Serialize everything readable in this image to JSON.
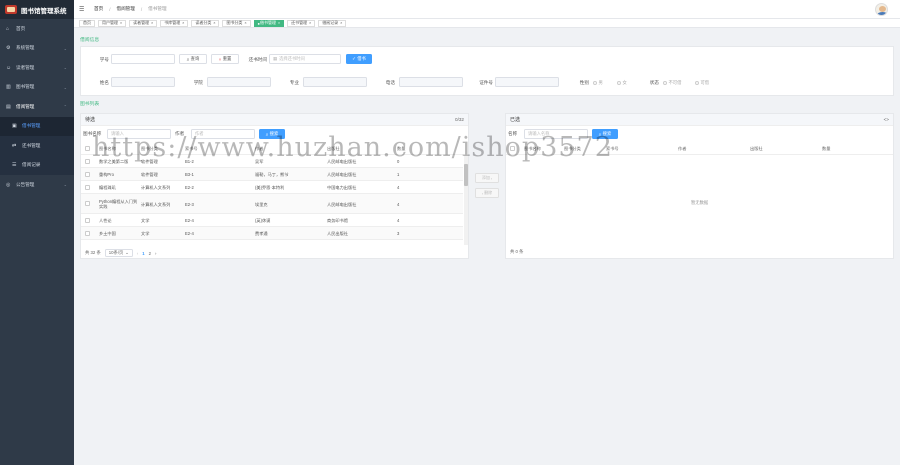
{
  "app": {
    "title": "图书馆管理系统"
  },
  "sidebar": {
    "items": [
      {
        "label": "首页",
        "icon": "home-icon"
      },
      {
        "label": "系统管理",
        "icon": "setting-icon"
      },
      {
        "label": "读者管理",
        "icon": "user-icon"
      },
      {
        "label": "图书管理",
        "icon": "book-icon"
      },
      {
        "label": "借阅管理",
        "icon": "borrow-icon"
      },
      {
        "label": "借书管理",
        "icon": "doc-icon"
      },
      {
        "label": "还书管理",
        "icon": "return-icon"
      },
      {
        "label": "借阅记录",
        "icon": "record-icon"
      },
      {
        "label": "公告管理",
        "icon": "notice-icon"
      }
    ]
  },
  "breadcrumb": [
    "首页",
    "借阅管理",
    "借书管理"
  ],
  "tabs": [
    "首页",
    "用户管理",
    "读者管理",
    "书库管理",
    "读者分类",
    "图书分类",
    "借书管理",
    "还书管理",
    "借阅记录"
  ],
  "search": {
    "section_title": "借阅信息",
    "reader_label": "学号",
    "query_label": "查询",
    "reset_label": "重置",
    "borrow_time_label": "还书时间",
    "borrow_time_placeholder": "选择还书时间",
    "confirm_label": "借书",
    "name_label": "姓名",
    "college_label": "学院",
    "major_label": "专业",
    "phone_label": "电话",
    "id_label": "证件号",
    "gender_label": "性别",
    "gender_male": "男",
    "gender_female": "女",
    "status_label": "状态",
    "status_unavailable": "不可借",
    "status_available": "可借"
  },
  "books": {
    "section_title": "图书列表",
    "left_title": "待选",
    "left_count": "0/32",
    "name_label": "图书名称",
    "name_placeholder": "请输入",
    "author_label": "作者",
    "author_placeholder": "作者",
    "search_label": "搜索",
    "columns": [
      "图书名称",
      "图书分类",
      "索书号",
      "作者",
      "出版社",
      "数量"
    ],
    "rows": [
      [
        "数学之美第二版",
        "软件管理",
        "B1-2",
        "吴军",
        "人民邮电出版社",
        "0"
      ],
      [
        "重构Pro",
        "软件管理",
        "B3-1",
        "福勒，马丁，熊节",
        "人民邮电出版社",
        "1"
      ],
      [
        "编程珠玑",
        "计算机人文系列",
        "E2-2",
        "(美)乔恩·本特利",
        "中国电力出版社",
        "4"
      ],
      [
        "Python编程从入门到实践",
        "计算机人文系列",
        "E2-3",
        "埃里克",
        "人民邮电出版社",
        "4"
      ],
      [
        "人性论",
        "文学",
        "E2-4",
        "(英)休谟",
        "商务印书馆",
        "4"
      ],
      [
        "乡土中国",
        "文学",
        "E2-4",
        "费孝通",
        "人民出版社",
        "3"
      ]
    ],
    "total": "共 32 条",
    "page_size": "10条/页",
    "pages": [
      "1",
      "2"
    ],
    "prev": "‹",
    "next": "›",
    "add_label": "添加",
    "remove_label": "删除",
    "right_title": "已选",
    "right_collapse": "<>",
    "right_name_label": "名称",
    "right_name_placeholder": "请输入名称",
    "right_search_label": "搜索",
    "right_columns": [
      "图书名称",
      "图书分类",
      "索书号",
      "作者",
      "出版社",
      "数量"
    ],
    "right_empty": "暂无数据",
    "right_total": "共 0 条"
  },
  "watermark": "https://www.huzhan.com/ishop3572",
  "colors": {
    "sidebar": "#2f3a48",
    "accent": "#42b983",
    "primary": "#409eff"
  }
}
